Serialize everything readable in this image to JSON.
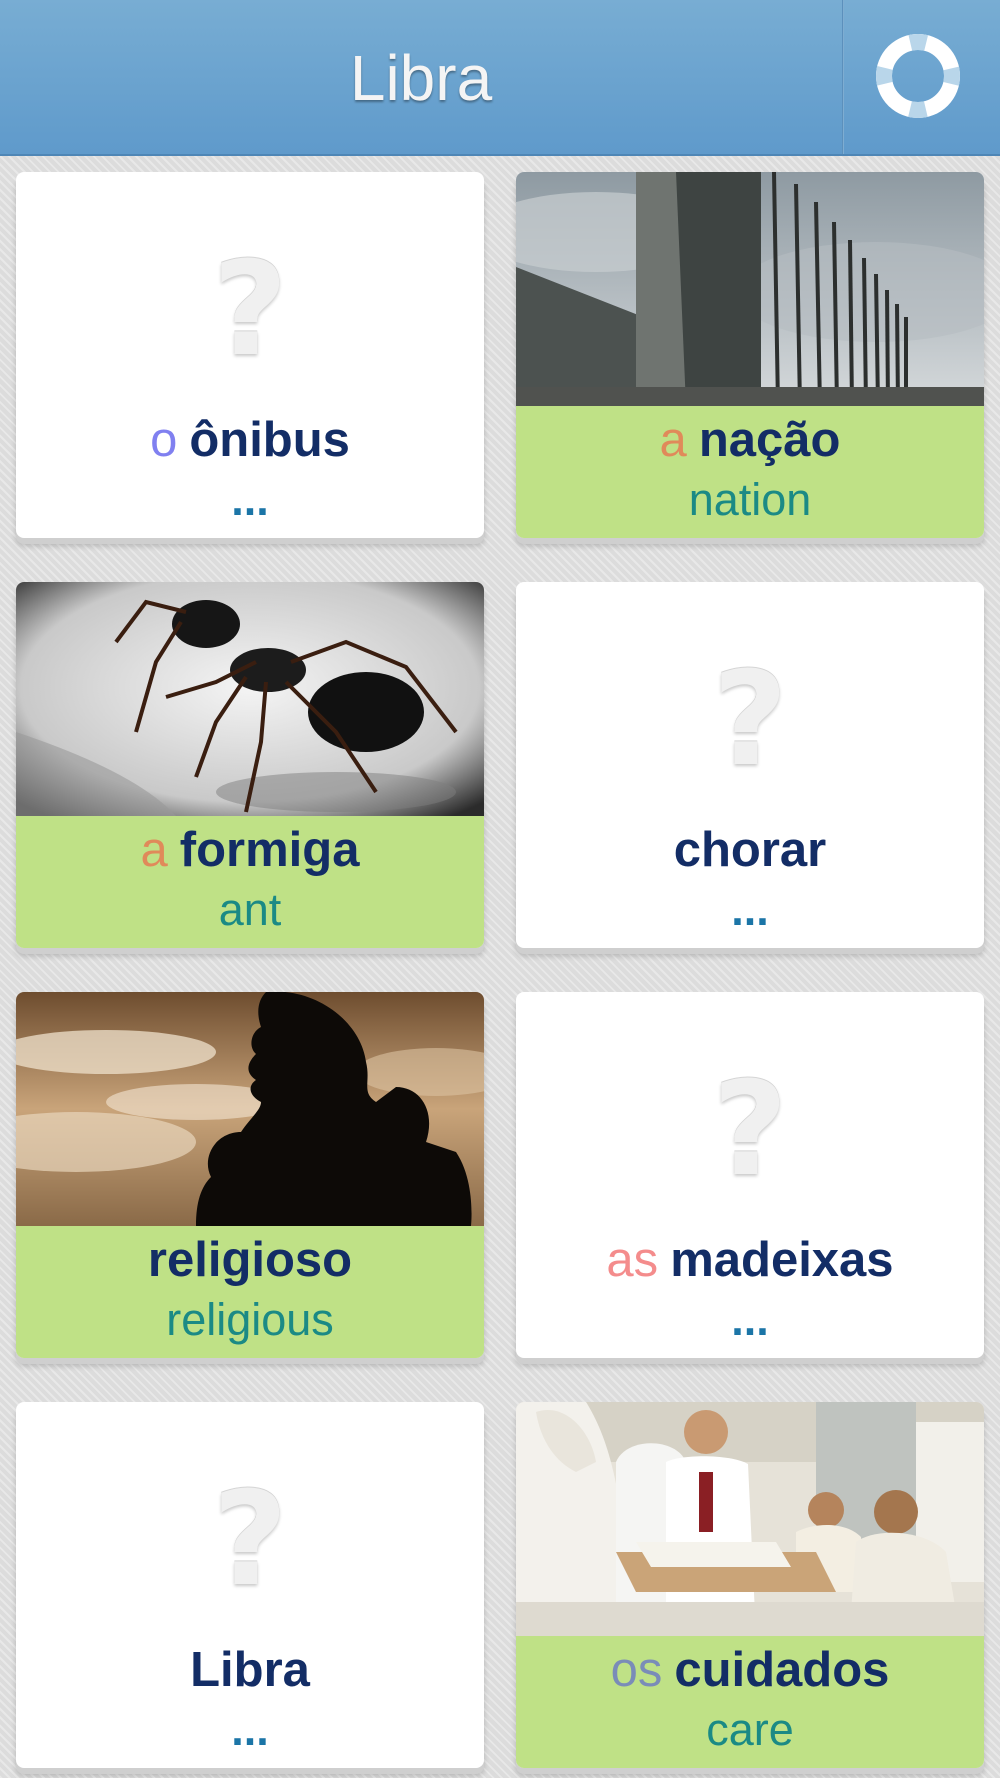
{
  "header": {
    "title": "Libra",
    "help_icon": "lifebuoy-icon"
  },
  "colors": {
    "header": "#6aa3cf",
    "learned_caption": "#bfe186",
    "word": "#132d66",
    "translation": "#1b8a85",
    "article_masculine": "#8080f0",
    "article_feminine": "#e08a5a",
    "article_feminine_plural": "#f48c8c",
    "article_masculine_plural": "#7a8cb8"
  },
  "cards": [
    {
      "article": "o",
      "word": "ônibus",
      "translation": "...",
      "state": "unknown",
      "image": "question-mark-icon"
    },
    {
      "article": "a",
      "word": "nação",
      "translation": "nation",
      "state": "learned",
      "image": "un-building-photo"
    },
    {
      "article": "a",
      "word": "formiga",
      "translation": "ant",
      "state": "learned",
      "image": "ant-photo"
    },
    {
      "article": "",
      "word": "chorar",
      "translation": "...",
      "state": "unknown",
      "image": "question-mark-icon"
    },
    {
      "article": "",
      "word": "religioso",
      "translation": "religious",
      "state": "learned",
      "image": "praying-silhouette-photo"
    },
    {
      "article": "as",
      "word": "madeixas",
      "translation": "...",
      "state": "unknown",
      "image": "question-mark-icon"
    },
    {
      "article": "",
      "word": "Libra",
      "translation": "...",
      "state": "unknown",
      "image": "question-mark-icon"
    },
    {
      "article": "os",
      "word": "cuidados",
      "translation": "care",
      "state": "learned",
      "image": "hospital-care-photo"
    }
  ]
}
